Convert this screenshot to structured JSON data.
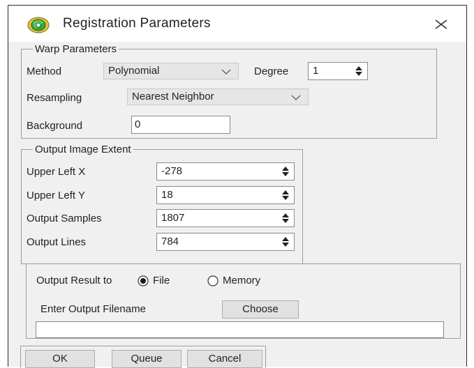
{
  "window": {
    "title": "Registration Parameters",
    "icon": "gear-globe-icon",
    "close_icon": "close-icon"
  },
  "warp": {
    "legend": "Warp Parameters",
    "method_label": "Method",
    "method_value": "Polynomial",
    "degree_label": "Degree",
    "degree_value": "1",
    "resampling_label": "Resampling",
    "resampling_value": "Nearest Neighbor",
    "background_label": "Background",
    "background_value": "0"
  },
  "extent": {
    "legend": "Output Image Extent",
    "fields": [
      {
        "label": "Upper Left X",
        "value": "-278"
      },
      {
        "label": "Upper Left Y",
        "value": "18"
      },
      {
        "label": "Output Samples",
        "value": "1807"
      },
      {
        "label": "Output Lines",
        "value": "784"
      }
    ]
  },
  "output": {
    "result_to_label": "Output Result to",
    "options": [
      {
        "label": "File",
        "selected": true
      },
      {
        "label": "Memory",
        "selected": false
      }
    ],
    "filename_label": "Enter Output Filename",
    "choose_label": "Choose",
    "filename_value": ""
  },
  "buttons": {
    "ok": "OK",
    "queue": "Queue",
    "cancel": "Cancel"
  },
  "colors": {
    "panel": "#f0f0f0",
    "icon_green": "#3aa23a",
    "icon_yellow": "#e8c233",
    "radio_dot": "#1a1a1a"
  }
}
